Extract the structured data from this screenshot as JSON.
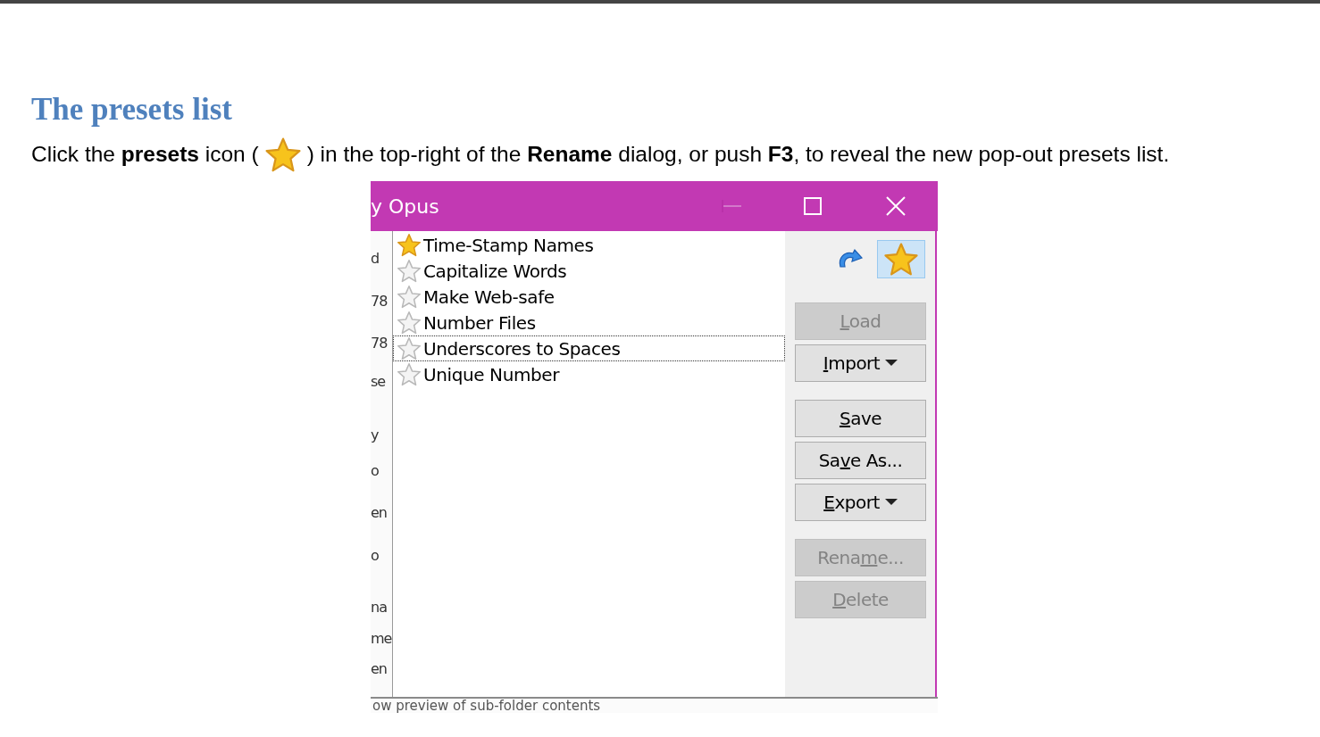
{
  "heading": "The presets list",
  "intro": {
    "before": "Click the **presets** icon (",
    "after": ") in the top-right of the **Rename** dialog, or push **F3**, to reveal the new pop-out presets list."
  },
  "dialog": {
    "title": "y Opus",
    "background_fragments": [
      "d",
      "78",
      "78",
      "se",
      "y",
      "o",
      "en",
      "o",
      "na",
      "me",
      "en"
    ],
    "background_bottom_text": "ow preview of sub-folder contents",
    "presets": [
      {
        "label": "Time-Stamp Names",
        "starred": true,
        "focused": false
      },
      {
        "label": "Capitalize Words",
        "starred": false,
        "focused": false
      },
      {
        "label": "Make Web-safe",
        "starred": false,
        "focused": false
      },
      {
        "label": "Number Files",
        "starred": false,
        "focused": false
      },
      {
        "label": "Underscores to Spaces",
        "starred": false,
        "focused": true
      },
      {
        "label": "Unique Number",
        "starred": false,
        "focused": false
      }
    ],
    "presets_button": {
      "pressed": true
    },
    "buttons": [
      {
        "key": "L",
        "after": "oad",
        "disabled": true,
        "dropdown": false
      },
      {
        "key": "I",
        "after": "mport",
        "disabled": false,
        "dropdown": true
      },
      {
        "key": "S",
        "after": "ave",
        "disabled": false,
        "dropdown": false
      },
      {
        "before": "Sa",
        "key": "v",
        "after": "e As...",
        "disabled": false,
        "dropdown": false
      },
      {
        "key": "E",
        "after": "xport",
        "disabled": false,
        "dropdown": true
      },
      {
        "before": "Rena",
        "key": "m",
        "after": "e...",
        "disabled": true,
        "dropdown": false
      },
      {
        "key": "D",
        "after": "elete",
        "disabled": true,
        "dropdown": false
      }
    ]
  }
}
